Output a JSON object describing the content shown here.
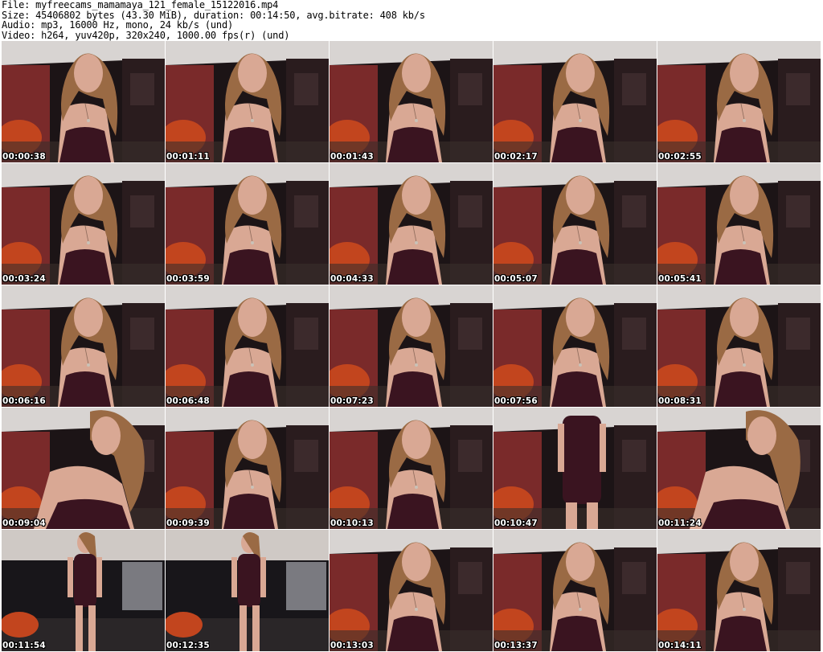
{
  "header": {
    "file_line": "File: myfreecams_mamamaya_121_female_15122016.mp4",
    "size_line": "Size: 45406802 bytes (43.30 MiB), duration: 00:14:50, avg.bitrate: 408 kb/s",
    "audio_line": "Audio: mp3, 16000 Hz, mono, 24 kb/s (und)",
    "video_line": "Video: h264, yuv420p, 320x240, 1000.00 fps(r) (und)"
  },
  "thumbnails": [
    {
      "time": "00:00:38",
      "scene": "seated-close"
    },
    {
      "time": "00:01:11",
      "scene": "seated-close"
    },
    {
      "time": "00:01:43",
      "scene": "seated-close"
    },
    {
      "time": "00:02:17",
      "scene": "seated-close"
    },
    {
      "time": "00:02:55",
      "scene": "seated-close"
    },
    {
      "time": "00:03:24",
      "scene": "seated-close"
    },
    {
      "time": "00:03:59",
      "scene": "seated-close"
    },
    {
      "time": "00:04:33",
      "scene": "seated-close"
    },
    {
      "time": "00:05:07",
      "scene": "seated-close"
    },
    {
      "time": "00:05:41",
      "scene": "seated-close"
    },
    {
      "time": "00:06:16",
      "scene": "seated-close"
    },
    {
      "time": "00:06:48",
      "scene": "seated-close"
    },
    {
      "time": "00:07:23",
      "scene": "seated-close"
    },
    {
      "time": "00:07:56",
      "scene": "seated-close"
    },
    {
      "time": "00:08:31",
      "scene": "seated-close"
    },
    {
      "time": "00:09:04",
      "scene": "leaning"
    },
    {
      "time": "00:09:39",
      "scene": "seated-close"
    },
    {
      "time": "00:10:13",
      "scene": "seated-close"
    },
    {
      "time": "00:10:47",
      "scene": "standing-dress"
    },
    {
      "time": "00:11:24",
      "scene": "leaning"
    },
    {
      "time": "00:11:54",
      "scene": "standing-full"
    },
    {
      "time": "00:12:35",
      "scene": "standing-full"
    },
    {
      "time": "00:13:03",
      "scene": "seated-close"
    },
    {
      "time": "00:13:37",
      "scene": "seated-close"
    },
    {
      "time": "00:14:11",
      "scene": "seated-close"
    }
  ],
  "colors": {
    "wall_red": "#7a2a2a",
    "dark_room": "#1c1416",
    "ceiling": "#d8d4d2",
    "skin": "#d9a894",
    "hair": "#9a6a44",
    "dress": "#3a1420",
    "chair_orange": "#c2451e"
  }
}
